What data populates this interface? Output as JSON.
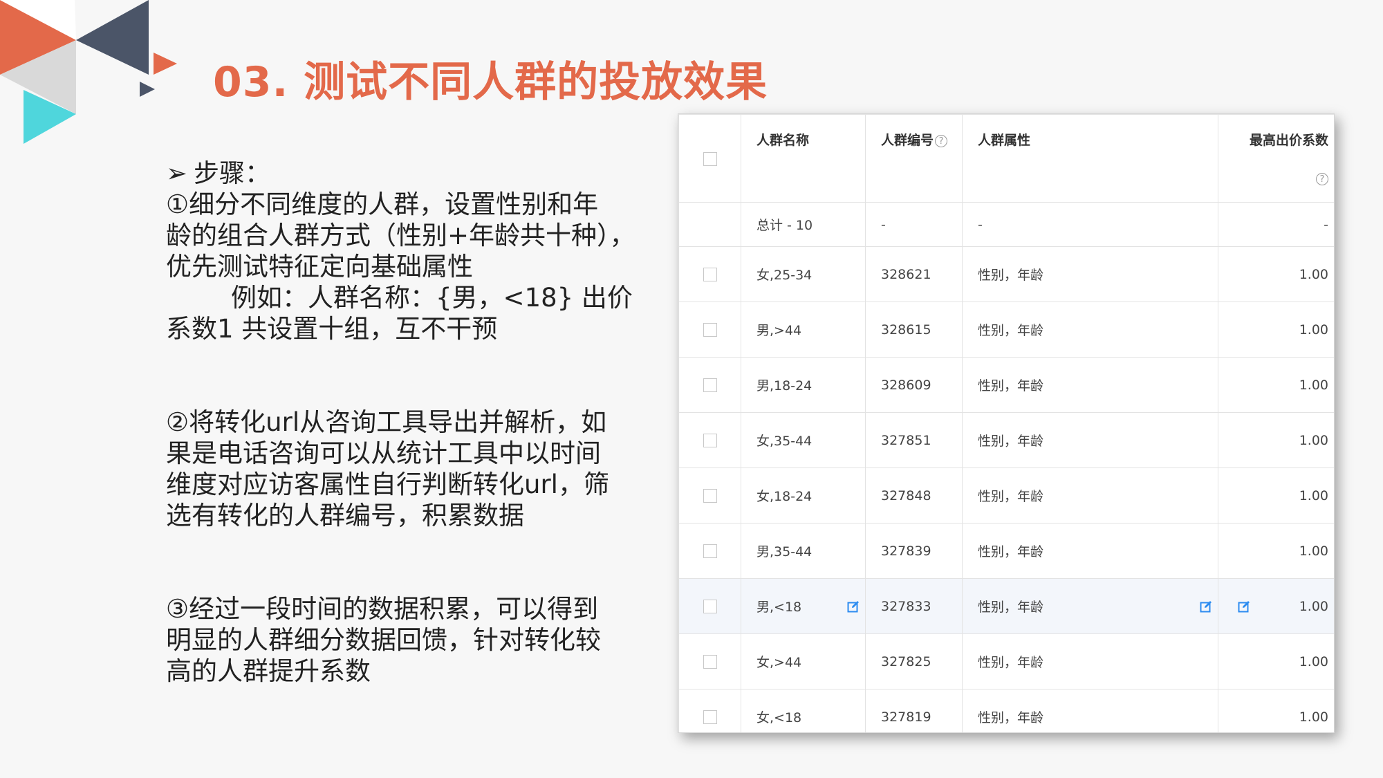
{
  "title": "03. 测试不同人群的投放效果",
  "colors": {
    "accent": "#e3694a",
    "navy": "#4b5568",
    "cyan": "#4fd6dc",
    "edit_blue": "#2d8cf0"
  },
  "steps": {
    "heading": "步骤：",
    "bullet_icon": "arrowhead-bullet",
    "p1_lines": [
      "①细分不同维度的人群，设置性别和年",
      "龄的组合人群方式（性别+年龄共十种），",
      "优先测试特征定向基础属性",
      "例如：人群名称：{男，<18}   出价",
      "系数1 共设置十组，互不干预"
    ],
    "p2_lines": [
      "②将转化url从咨询工具导出并解析，如",
      "果是电话咨询可以从统计工具中以时间",
      "维度对应访客属性自行判断转化url，筛",
      "选有转化的人群编号，积累数据"
    ],
    "p3_lines": [
      "③经过一段时间的数据积累，可以得到",
      "明显的人群细分数据回馈，针对转化较",
      "高的人群提升系数"
    ]
  },
  "table": {
    "headers": {
      "name": "人群名称",
      "id": "人群编号",
      "attr": "人群属性",
      "bid": "最高出价系数"
    },
    "total": {
      "name": "总计 - 10",
      "id": "-",
      "attr": "-",
      "bid": "-"
    },
    "rows": [
      {
        "name": "女,25-34",
        "id": "328621",
        "attr": "性别，年龄",
        "bid": "1.00"
      },
      {
        "name": "男,>44",
        "id": "328615",
        "attr": "性别，年龄",
        "bid": "1.00"
      },
      {
        "name": "男,18-24",
        "id": "328609",
        "attr": "性别，年龄",
        "bid": "1.00"
      },
      {
        "name": "女,35-44",
        "id": "327851",
        "attr": "性别，年龄",
        "bid": "1.00"
      },
      {
        "name": "女,18-24",
        "id": "327848",
        "attr": "性别，年龄",
        "bid": "1.00"
      },
      {
        "name": "男,35-44",
        "id": "327839",
        "attr": "性别，年龄",
        "bid": "1.00"
      },
      {
        "name": "男,<18",
        "id": "327833",
        "attr": "性别，年龄",
        "bid": "1.00"
      },
      {
        "name": "女,>44",
        "id": "327825",
        "attr": "性别，年龄",
        "bid": "1.00"
      },
      {
        "name": "女,<18",
        "id": "327819",
        "attr": "性别，年龄",
        "bid": "1.00"
      }
    ]
  }
}
